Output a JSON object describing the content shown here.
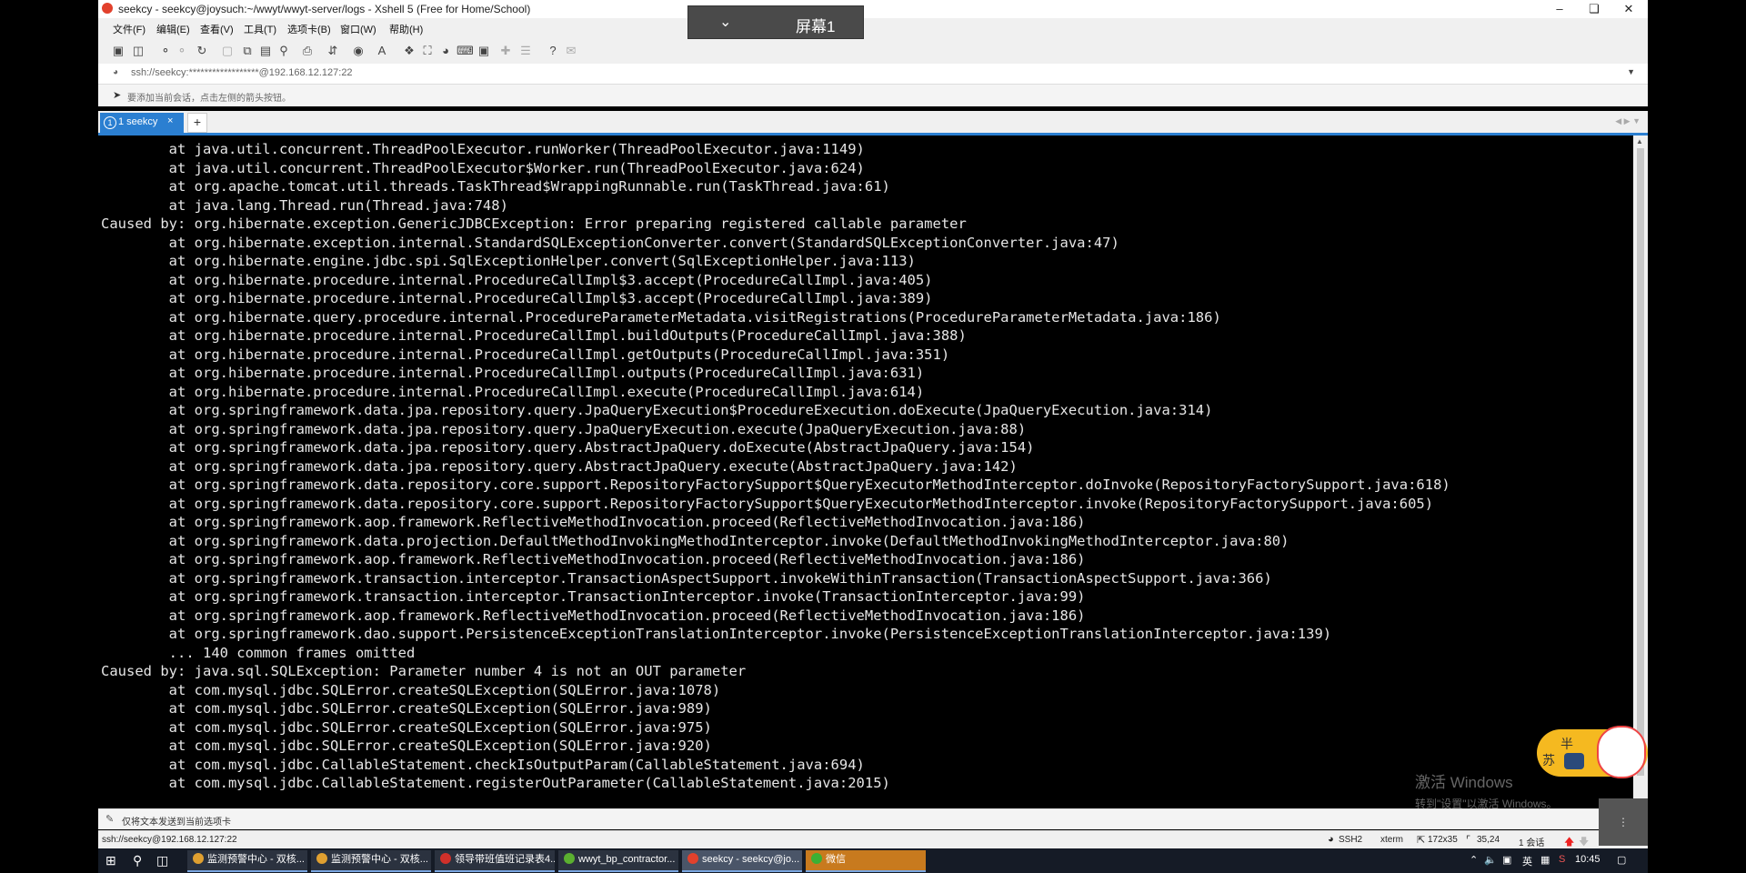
{
  "window": {
    "title": "seekcy - seekcy@joysuch:~/wwyt/wwyt-server/logs - Xshell 5 (Free for Home/School)"
  },
  "banner": {
    "label": "屏幕1"
  },
  "menu": [
    "文件(F)",
    "编辑(E)",
    "查看(V)",
    "工具(T)",
    "选项卡(B)",
    "窗口(W)",
    "帮助(H)"
  ],
  "address": {
    "value": "ssh://seekcy:******************@192.168.12.127:22"
  },
  "hint": {
    "text": "要添加当前会话，点击左侧的箭头按钮。"
  },
  "tabs": [
    {
      "index": "1",
      "label": "1 seekcy",
      "close": "×"
    }
  ],
  "new_tab": "+",
  "terminal": {
    "lines": [
      "        at java.util.concurrent.ThreadPoolExecutor.runWorker(ThreadPoolExecutor.java:1149)",
      "        at java.util.concurrent.ThreadPoolExecutor$Worker.run(ThreadPoolExecutor.java:624)",
      "        at org.apache.tomcat.util.threads.TaskThread$WrappingRunnable.run(TaskThread.java:61)",
      "        at java.lang.Thread.run(Thread.java:748)",
      "Caused by: org.hibernate.exception.GenericJDBCException: Error preparing registered callable parameter",
      "        at org.hibernate.exception.internal.StandardSQLExceptionConverter.convert(StandardSQLExceptionConverter.java:47)",
      "        at org.hibernate.engine.jdbc.spi.SqlExceptionHelper.convert(SqlExceptionHelper.java:113)",
      "        at org.hibernate.procedure.internal.ProcedureCallImpl$3.accept(ProcedureCallImpl.java:405)",
      "        at org.hibernate.procedure.internal.ProcedureCallImpl$3.accept(ProcedureCallImpl.java:389)",
      "        at org.hibernate.query.procedure.internal.ProcedureParameterMetadata.visitRegistrations(ProcedureParameterMetadata.java:186)",
      "        at org.hibernate.procedure.internal.ProcedureCallImpl.buildOutputs(ProcedureCallImpl.java:388)",
      "        at org.hibernate.procedure.internal.ProcedureCallImpl.getOutputs(ProcedureCallImpl.java:351)",
      "        at org.hibernate.procedure.internal.ProcedureCallImpl.outputs(ProcedureCallImpl.java:631)",
      "        at org.hibernate.procedure.internal.ProcedureCallImpl.execute(ProcedureCallImpl.java:614)",
      "        at org.springframework.data.jpa.repository.query.JpaQueryExecution$ProcedureExecution.doExecute(JpaQueryExecution.java:314)",
      "        at org.springframework.data.jpa.repository.query.JpaQueryExecution.execute(JpaQueryExecution.java:88)",
      "        at org.springframework.data.jpa.repository.query.AbstractJpaQuery.doExecute(AbstractJpaQuery.java:154)",
      "        at org.springframework.data.jpa.repository.query.AbstractJpaQuery.execute(AbstractJpaQuery.java:142)",
      "        at org.springframework.data.repository.core.support.RepositoryFactorySupport$QueryExecutorMethodInterceptor.doInvoke(RepositoryFactorySupport.java:618)",
      "        at org.springframework.data.repository.core.support.RepositoryFactorySupport$QueryExecutorMethodInterceptor.invoke(RepositoryFactorySupport.java:605)",
      "        at org.springframework.aop.framework.ReflectiveMethodInvocation.proceed(ReflectiveMethodInvocation.java:186)",
      "        at org.springframework.data.projection.DefaultMethodInvokingMethodInterceptor.invoke(DefaultMethodInvokingMethodInterceptor.java:80)",
      "        at org.springframework.aop.framework.ReflectiveMethodInvocation.proceed(ReflectiveMethodInvocation.java:186)",
      "        at org.springframework.transaction.interceptor.TransactionAspectSupport.invokeWithinTransaction(TransactionAspectSupport.java:366)",
      "        at org.springframework.transaction.interceptor.TransactionInterceptor.invoke(TransactionInterceptor.java:99)",
      "        at org.springframework.aop.framework.ReflectiveMethodInvocation.proceed(ReflectiveMethodInvocation.java:186)",
      "        at org.springframework.dao.support.PersistenceExceptionTranslationInterceptor.invoke(PersistenceExceptionTranslationInterceptor.java:139)",
      "        ... 140 common frames omitted",
      "Caused by: java.sql.SQLException: Parameter number 4 is not an OUT parameter",
      "        at com.mysql.jdbc.SQLError.createSQLException(SQLError.java:1078)",
      "        at com.mysql.jdbc.SQLError.createSQLException(SQLError.java:989)",
      "        at com.mysql.jdbc.SQLError.createSQLException(SQLError.java:975)",
      "        at com.mysql.jdbc.SQLError.createSQLException(SQLError.java:920)",
      "        at com.mysql.jdbc.CallableStatement.checkIsOutputParam(CallableStatement.java:694)",
      "        at com.mysql.jdbc.CallableStatement.registerOutParameter(CallableStatement.java:2015)"
    ]
  },
  "activation": {
    "line1": "激活 Windows",
    "line2": "转到\"设置\"以激活 Windows。"
  },
  "send_bar": {
    "text": "仅将文本发送到当前选项卡"
  },
  "status": {
    "connection": "ssh://seekcy@192.168.12.127:22",
    "protocol": "SSH2",
    "terminal_type": "xterm",
    "size": "172x35",
    "cursor": "35,24",
    "sessions": "1 会话"
  },
  "taskbar": {
    "items": [
      {
        "label": "监测预警中心 - 双核...",
        "color": "#e0a030"
      },
      {
        "label": "监测预警中心 - 双核...",
        "color": "#e0a030"
      },
      {
        "label": "领导带班值班记录表4...",
        "color": "#d0302a"
      },
      {
        "label": "wwyt_bp_contractor...",
        "color": "#5bb030"
      },
      {
        "label": "seekcy - seekcy@jo...",
        "color": "#e2412c"
      },
      {
        "label": "微信",
        "color": "#3cb034"
      }
    ],
    "tray": {
      "lang": "英",
      "time": "10:45"
    }
  },
  "widget": {
    "char1": "半",
    "char2": "苏"
  },
  "colors": {
    "accent": "#2b7fd1",
    "terminal_bg": "#000000",
    "terminal_fg": "#e6e6e6"
  }
}
